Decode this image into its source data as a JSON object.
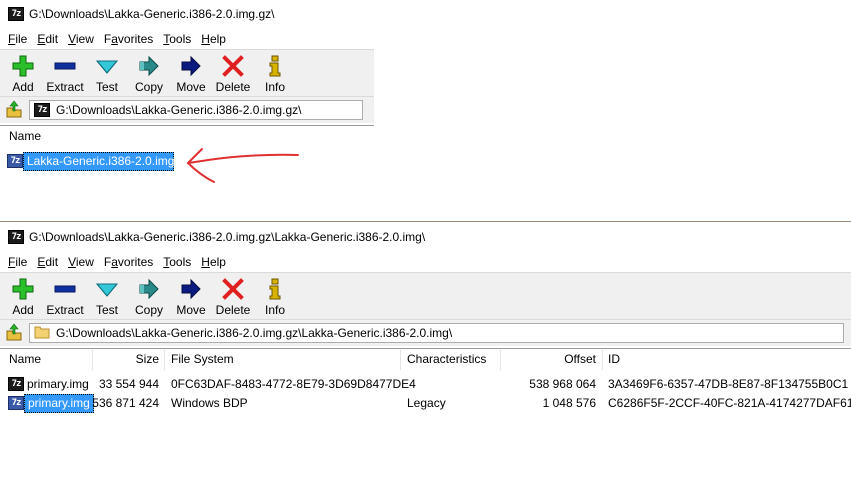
{
  "top_window": {
    "title": "G:\\Downloads\\Lakka-Generic.i386-2.0.img.gz\\",
    "menu": [
      {
        "pre": "",
        "key": "F",
        "post": "ile"
      },
      {
        "pre": "",
        "key": "E",
        "post": "dit"
      },
      {
        "pre": "",
        "key": "V",
        "post": "iew"
      },
      {
        "pre": "F",
        "key": "a",
        "post": "vorites"
      },
      {
        "pre": "",
        "key": "T",
        "post": "ools"
      },
      {
        "pre": "",
        "key": "H",
        "post": "elp"
      }
    ],
    "toolbar": {
      "add": "Add",
      "extract": "Extract",
      "test": "Test",
      "copy": "Copy",
      "move": "Move",
      "delete": "Delete",
      "info": "Info"
    },
    "address": "G:\\Downloads\\Lakka-Generic.i386-2.0.img.gz\\",
    "columns": {
      "name": "Name"
    },
    "rows": [
      {
        "name": "Lakka-Generic.i386-2.0.img"
      }
    ]
  },
  "bottom_window": {
    "title": "G:\\Downloads\\Lakka-Generic.i386-2.0.img.gz\\Lakka-Generic.i386-2.0.img\\",
    "menu": [
      {
        "pre": "",
        "key": "F",
        "post": "ile"
      },
      {
        "pre": "",
        "key": "E",
        "post": "dit"
      },
      {
        "pre": "",
        "key": "V",
        "post": "iew"
      },
      {
        "pre": "F",
        "key": "a",
        "post": "vorites"
      },
      {
        "pre": "",
        "key": "T",
        "post": "ools"
      },
      {
        "pre": "",
        "key": "H",
        "post": "elp"
      }
    ],
    "toolbar": {
      "add": "Add",
      "extract": "Extract",
      "test": "Test",
      "copy": "Copy",
      "move": "Move",
      "delete": "Delete",
      "info": "Info"
    },
    "address": "G:\\Downloads\\Lakka-Generic.i386-2.0.img.gz\\Lakka-Generic.i386-2.0.img\\",
    "columns": {
      "name": "Name",
      "size": "Size",
      "file_system": "File System",
      "characteristics": "Characteristics",
      "offset": "Offset",
      "id": "ID"
    },
    "rows": [
      {
        "name": "primary.img",
        "size": "33 554 944",
        "file_system": "0FC63DAF-8483-4772-8E79-3D69D8477DE4",
        "characteristics": "",
        "offset": "538 968 064",
        "id": "3A3469F6-6357-47DB-8E87-8F134755B0C1"
      },
      {
        "name": "primary.img",
        "size": "536 871 424",
        "file_system": "Windows BDP",
        "characteristics": "Legacy",
        "offset": "1 048 576",
        "id": "C6286F5F-2CCF-40FC-821A-4174277DAF61"
      }
    ]
  },
  "icons": {
    "app": "7z-app-icon",
    "add": "plus-icon",
    "extract": "minus-icon",
    "test": "check-icon",
    "copy": "double-arrow-icon",
    "move": "arrow-right-icon",
    "delete": "x-icon",
    "info": "info-icon",
    "up": "folder-up-icon",
    "folder": "folder-icon",
    "annotation": "red-arrow-annotation"
  },
  "colors": {
    "selection": "#3399ff",
    "add": "#2bbf2b",
    "extract": "#1030a0",
    "test": "#33c8d8",
    "copy": "#2a8a8a",
    "move": "#0a1a80",
    "delete": "#e02020",
    "info": "#d8b400",
    "annotation": "#e03030"
  }
}
